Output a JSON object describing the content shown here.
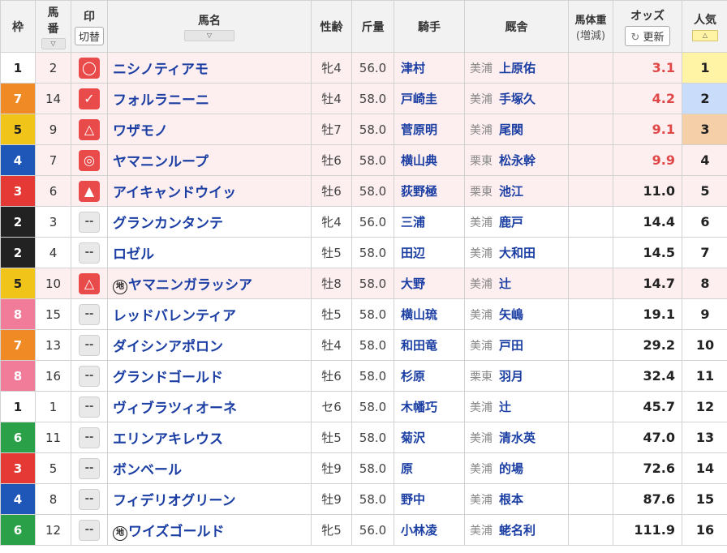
{
  "header": {
    "waku": "枠",
    "umaban_line1": "馬",
    "umaban_line2": "番",
    "sort_icon": "▽",
    "mark": "印",
    "mark_toggle": "切替",
    "name": "馬名",
    "sexage": "性齢",
    "kinryo": "斤量",
    "jockey": "騎手",
    "trainer": "厩舎",
    "weight_line1": "馬体重",
    "weight_line2": "(増減)",
    "odds": "オッズ",
    "refresh": "更新",
    "refresh_icon": "refresh-icon",
    "popularity": "人気",
    "popularity_sort_icon": "△"
  },
  "colors": {
    "waku": {
      "1": "#ffffff",
      "2": "#222222",
      "3": "#e53935",
      "4": "#1e57b8",
      "5": "#f0c419",
      "6": "#2aa148",
      "7": "#f08a24",
      "8": "#f07c9a"
    },
    "mark_red": "#e94b4b",
    "pop1": "#fff3a6",
    "pop2": "#c9ddfa",
    "pop3": "#f4cfa8",
    "link": "#1b3ea3",
    "hot_odds": "#e04848"
  },
  "rows": [
    {
      "waku": "1",
      "umaban": "2",
      "mark": "◯",
      "chiho": "",
      "name": "ニシノティアモ",
      "sexage": "牝4",
      "kinryo": "56.0",
      "jockey": "津村",
      "area": "美浦",
      "trainer": "上原佑",
      "odds": "3.1",
      "ninki": "1"
    },
    {
      "waku": "7",
      "umaban": "14",
      "mark": "✓",
      "chiho": "",
      "name": "フォルラニーニ",
      "sexage": "牡4",
      "kinryo": "58.0",
      "jockey": "戸崎圭",
      "area": "美浦",
      "trainer": "手塚久",
      "odds": "4.2",
      "ninki": "2"
    },
    {
      "waku": "5",
      "umaban": "9",
      "mark": "△",
      "chiho": "",
      "name": "ワザモノ",
      "sexage": "牡7",
      "kinryo": "58.0",
      "jockey": "菅原明",
      "area": "美浦",
      "trainer": "尾関",
      "odds": "9.1",
      "ninki": "3"
    },
    {
      "waku": "4",
      "umaban": "7",
      "mark": "◎",
      "chiho": "",
      "name": "ヤマニンループ",
      "sexage": "牡6",
      "kinryo": "58.0",
      "jockey": "横山典",
      "area": "栗東",
      "trainer": "松永幹",
      "odds": "9.9",
      "ninki": "4"
    },
    {
      "waku": "3",
      "umaban": "6",
      "mark": "▲",
      "chiho": "",
      "name": "アイキャンドウイッ",
      "sexage": "牡6",
      "kinryo": "58.0",
      "jockey": "荻野極",
      "area": "栗東",
      "trainer": "池江",
      "odds": "11.0",
      "ninki": "5"
    },
    {
      "waku": "2",
      "umaban": "3",
      "mark": "--",
      "chiho": "",
      "name": "グランカンタンテ",
      "sexage": "牝4",
      "kinryo": "56.0",
      "jockey": "三浦",
      "area": "美浦",
      "trainer": "鹿戸",
      "odds": "14.4",
      "ninki": "6"
    },
    {
      "waku": "2",
      "umaban": "4",
      "mark": "--",
      "chiho": "",
      "name": "ロゼル",
      "sexage": "牡5",
      "kinryo": "58.0",
      "jockey": "田辺",
      "area": "美浦",
      "trainer": "大和田",
      "odds": "14.5",
      "ninki": "7"
    },
    {
      "waku": "5",
      "umaban": "10",
      "mark": "△",
      "chiho": "地",
      "name": "ヤマニンガラッシア",
      "sexage": "牡8",
      "kinryo": "58.0",
      "jockey": "大野",
      "area": "美浦",
      "trainer": "辻",
      "odds": "14.7",
      "ninki": "8"
    },
    {
      "waku": "8",
      "umaban": "15",
      "mark": "--",
      "chiho": "",
      "name": "レッドバレンティア",
      "sexage": "牡5",
      "kinryo": "58.0",
      "jockey": "横山琉",
      "area": "美浦",
      "trainer": "矢嶋",
      "odds": "19.1",
      "ninki": "9"
    },
    {
      "waku": "7",
      "umaban": "13",
      "mark": "--",
      "chiho": "",
      "name": "ダイシンアポロン",
      "sexage": "牡4",
      "kinryo": "58.0",
      "jockey": "和田竜",
      "area": "美浦",
      "trainer": "戸田",
      "odds": "29.2",
      "ninki": "10"
    },
    {
      "waku": "8",
      "umaban": "16",
      "mark": "--",
      "chiho": "",
      "name": "グランドゴールド",
      "sexage": "牡6",
      "kinryo": "58.0",
      "jockey": "杉原",
      "area": "栗東",
      "trainer": "羽月",
      "odds": "32.4",
      "ninki": "11"
    },
    {
      "waku": "1",
      "umaban": "1",
      "mark": "--",
      "chiho": "",
      "name": "ヴィブラツィオーネ",
      "sexage": "セ6",
      "kinryo": "58.0",
      "jockey": "木幡巧",
      "area": "美浦",
      "trainer": "辻",
      "odds": "45.7",
      "ninki": "12"
    },
    {
      "waku": "6",
      "umaban": "11",
      "mark": "--",
      "chiho": "",
      "name": "エリンアキレウス",
      "sexage": "牡5",
      "kinryo": "58.0",
      "jockey": "菊沢",
      "area": "美浦",
      "trainer": "清水英",
      "odds": "47.0",
      "ninki": "13"
    },
    {
      "waku": "3",
      "umaban": "5",
      "mark": "--",
      "chiho": "",
      "name": "ボンベール",
      "sexage": "牡9",
      "kinryo": "58.0",
      "jockey": "原",
      "area": "美浦",
      "trainer": "的場",
      "odds": "72.6",
      "ninki": "14"
    },
    {
      "waku": "4",
      "umaban": "8",
      "mark": "--",
      "chiho": "",
      "name": "フィデリオグリーン",
      "sexage": "牡9",
      "kinryo": "58.0",
      "jockey": "野中",
      "area": "美浦",
      "trainer": "根本",
      "odds": "87.6",
      "ninki": "15"
    },
    {
      "waku": "6",
      "umaban": "12",
      "mark": "--",
      "chiho": "地",
      "name": "ワイズゴールド",
      "sexage": "牝5",
      "kinryo": "56.0",
      "jockey": "小林凌",
      "area": "美浦",
      "trainer": "蛯名利",
      "odds": "111.9",
      "ninki": "16"
    }
  ]
}
